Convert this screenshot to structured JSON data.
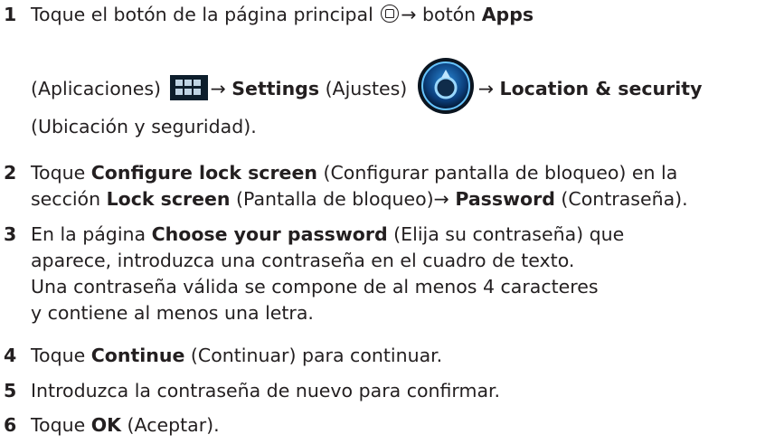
{
  "steps": [
    {
      "number": "1",
      "lines": [
        {
          "t1": "Toque el botón de la página principal ",
          "arrow": "→ botón ",
          "b1": "Apps"
        },
        {
          "t1": "(Aplicaciones) ",
          "t2": "→ ",
          "b1": "Settings",
          "t3": " (Ajustes) ",
          "t4": "→ ",
          "b2": "Location & security"
        },
        {
          "t1": "(Ubicación y seguridad)."
        }
      ]
    },
    {
      "number": "2",
      "lines": [
        {
          "t1": "Toque ",
          "b1": "Configure lock screen",
          "t2": " (Configurar pantalla de bloqueo) en la"
        },
        {
          "t1": "sección ",
          "b1": "Lock screen",
          "t2": " (Pantalla de bloqueo)→ ",
          "b2": "Password",
          "t3": " (Contraseña)."
        }
      ]
    },
    {
      "number": "3",
      "lines": [
        {
          "t1": "En la página ",
          "b1": "Choose your password",
          "t2": " (Elija su contraseña) que"
        },
        {
          "t1": "aparece, introduzca una contraseña en el cuadro de texto."
        },
        {
          "t1": "Una contraseña válida se compone de al menos 4 caracteres"
        },
        {
          "t1": "y contiene al menos una letra."
        }
      ]
    },
    {
      "number": "4",
      "lines": [
        {
          "t1": "Toque ",
          "b1": "Continue",
          "t2": " (Continuar) para continuar."
        }
      ]
    },
    {
      "number": "5",
      "lines": [
        {
          "t1": "Introduzca la contraseña de nuevo para confirmar."
        }
      ]
    },
    {
      "number": "6",
      "lines": [
        {
          "t1": "Toque ",
          "b1": "OK",
          "t2": " (Aceptar)."
        }
      ]
    }
  ],
  "icons": {
    "home": "home-icon",
    "apps": "apps-grid-icon",
    "settings": "settings-gear-icon"
  }
}
